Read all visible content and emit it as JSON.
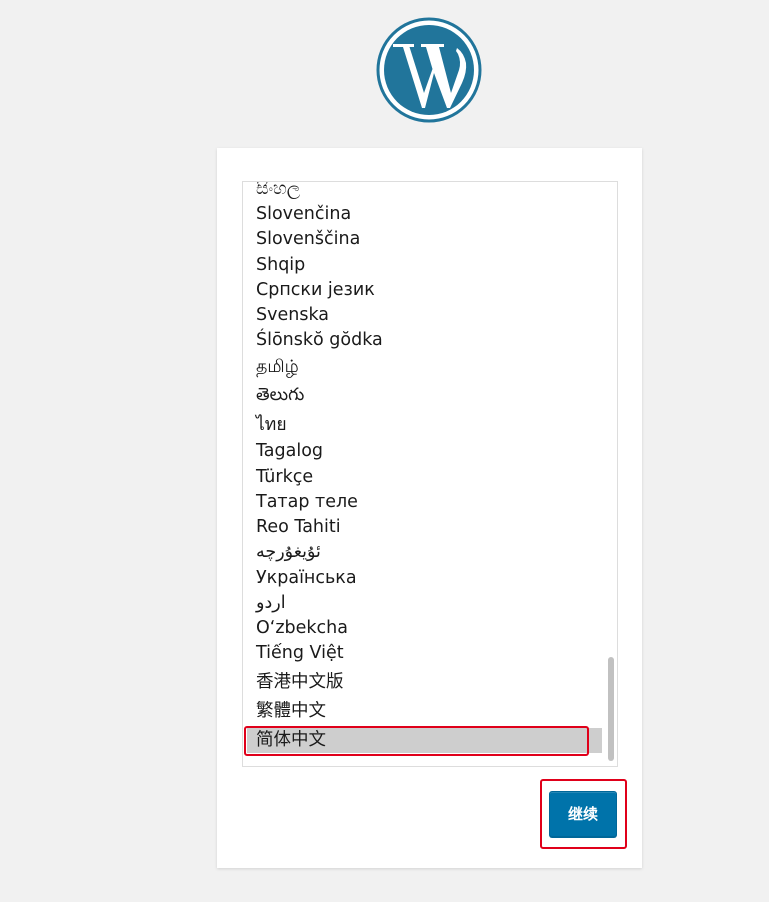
{
  "colors": {
    "page_background": "#f1f1f1",
    "wordpress_blue": "#21759b",
    "button_blue": "#0073aa",
    "selected_row": "#cecece",
    "annotation_red": "#e0001a"
  },
  "logo": {
    "icon": "wordpress-logo-icon"
  },
  "language_list": {
    "items": [
      "සිංහල",
      "Slovenčina",
      "Slovenščina",
      "Shqip",
      "Српски језик",
      "Svenska",
      "Ślōnskŏ gŏdka",
      "தமிழ்",
      "తెలుగు",
      "ไทย",
      "Tagalog",
      "Türkçe",
      "Татар теле",
      "Reo Tahiti",
      "ئۇيغۇرچە",
      "Українська",
      "اردو",
      "O‘zbekcha",
      "Tiếng Việt",
      "香港中文版",
      "繁體中文",
      "简体中文"
    ],
    "selected": "简体中文"
  },
  "continue_button": {
    "label": "继续"
  }
}
